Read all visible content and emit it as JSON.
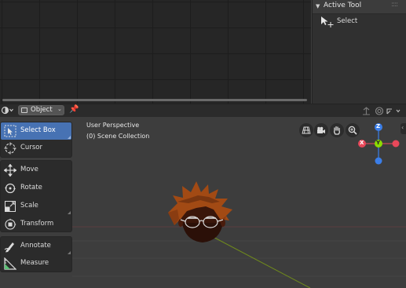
{
  "colors": {
    "accent": "#4772b3",
    "axis_x": "#e8485a",
    "axis_y": "#8bdc00",
    "axis_z": "#3b7ee8",
    "hair": "#a24a14",
    "skin": "#3a160a"
  },
  "active_tool_panel": {
    "title": "Active Tool",
    "tool_label": "Select",
    "tool_icon": "select-cursor-icon"
  },
  "header": {
    "editor_type_icon": "viewport-sphere-icon",
    "mode_label": "Object",
    "mode_icon": "object-mode-icon",
    "pin_icon": "pin-icon"
  },
  "viewport": {
    "perspective_label": "User Perspective",
    "collection_label": "(0) Scene Collection"
  },
  "toolbar": {
    "select_box": "Select Box",
    "cursor": "Cursor",
    "move": "Move",
    "rotate": "Rotate",
    "scale": "Scale",
    "transform": "Transform",
    "annotate": "Annotate",
    "measure": "Measure"
  },
  "gizmo": {
    "x_label": "X",
    "y_label": "Y",
    "z_label": "Z"
  }
}
